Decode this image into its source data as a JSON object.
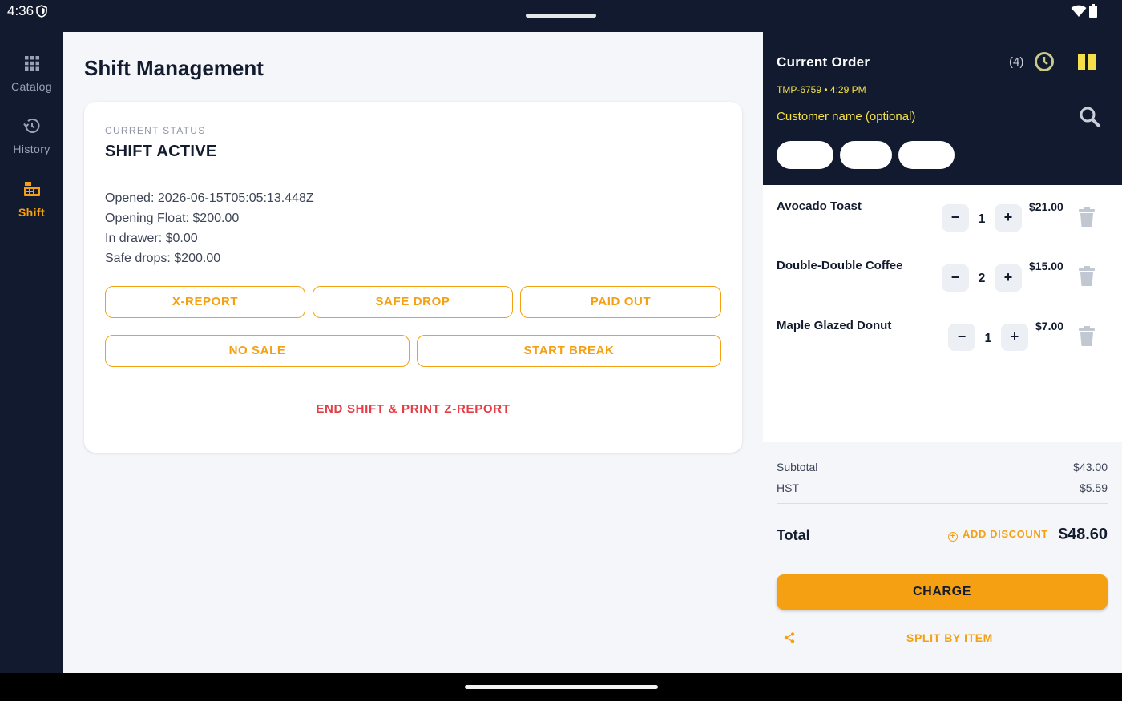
{
  "status_bar": {
    "time": "4:36"
  },
  "rail": {
    "items": [
      {
        "label": "Catalog",
        "icon": "grid-icon",
        "active": false
      },
      {
        "label": "History",
        "icon": "history-icon",
        "active": false
      },
      {
        "label": "Shift",
        "icon": "cash-register-icon",
        "active": true
      }
    ]
  },
  "main": {
    "title": "Shift Management",
    "card": {
      "overline": "CURRENT STATUS",
      "status": "SHIFT ACTIVE",
      "opened": "Opened: 2026-06-15T05:05:13.448Z",
      "opening_float": "Opening Float: $200.00",
      "in_drawer": "In drawer: $0.00",
      "safe_drops": "Safe drops: $200.00",
      "buttons": [
        "X-REPORT",
        "SAFE DROP",
        "PAID OUT",
        "NO SALE",
        "START BREAK"
      ],
      "end_shift": "END SHIFT & PRINT Z-REPORT"
    }
  },
  "order": {
    "title": "Current Order",
    "count": "(4)",
    "ticket": "TMP-6759 • 4:29 PM",
    "customer_placeholder": "Customer name (optional)",
    "items": [
      {
        "name": "Avocado Toast",
        "qty": "1",
        "price": "$21.00"
      },
      {
        "name": "Double-Double Coffee",
        "qty": "2",
        "price": "$15.00"
      },
      {
        "name": "Maple Glazed Donut",
        "qty": "1",
        "price": "$7.00"
      }
    ],
    "minus": "−",
    "plus": "+",
    "subtotal_label": "Subtotal",
    "subtotal": "$43.00",
    "tax_label": "HST",
    "tax": "$5.59",
    "total_label": "Total",
    "add_discount": "ADD DISCOUNT",
    "total": "$48.60",
    "charge": "CHARGE",
    "split": "SPLIT BY ITEM"
  },
  "colors": {
    "accent": "#f4a012",
    "danger": "#e53c45",
    "dark": "#111a2e",
    "highlight": "#f5e04a"
  }
}
